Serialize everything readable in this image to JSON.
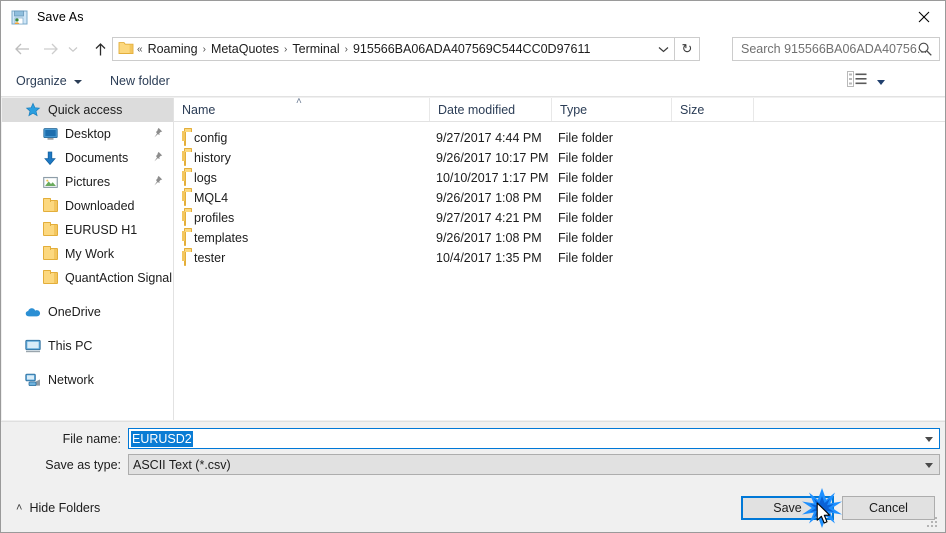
{
  "window": {
    "title": "Save As",
    "icon": "save-as-icon",
    "close_label": "✕"
  },
  "nav": {
    "back_icon": "arrow-left-icon",
    "forward_icon": "arrow-right-icon",
    "recent_icon": "chevron-down-icon",
    "up_icon": "arrow-up-icon",
    "refresh_icon": "↻",
    "breadcrumb_prefix": "«",
    "breadcrumbs": [
      "Roaming",
      "MetaQuotes",
      "Terminal",
      "915566BA06ADA407569C544CC0D97611"
    ],
    "separator": "›",
    "dropdown_icon": "chevron-down-icon"
  },
  "search": {
    "placeholder": "Search 915566BA06ADA40756...",
    "icon": "search-icon"
  },
  "commandbar": {
    "organize": "Organize",
    "new_folder": "New folder",
    "view_icon": "view-options-icon",
    "help_label": "?"
  },
  "sidebar": {
    "items": [
      {
        "label": "Quick access",
        "icon": "star-icon",
        "level": 0,
        "selected": true,
        "pinned": false
      },
      {
        "label": "Desktop",
        "icon": "monitor-icon",
        "level": 1,
        "selected": false,
        "pinned": true
      },
      {
        "label": "Documents",
        "icon": "download-icon",
        "level": 1,
        "selected": false,
        "pinned": true
      },
      {
        "label": "Pictures",
        "icon": "picture-icon",
        "level": 1,
        "selected": false,
        "pinned": true
      },
      {
        "label": "Downloaded",
        "icon": "folder-icon",
        "level": 1,
        "selected": false,
        "pinned": false
      },
      {
        "label": "EURUSD H1",
        "icon": "folder-icon",
        "level": 1,
        "selected": false,
        "pinned": false
      },
      {
        "label": "My Work",
        "icon": "folder-icon",
        "level": 1,
        "selected": false,
        "pinned": false
      },
      {
        "label": "QuantAction Signal",
        "icon": "folder-icon",
        "level": 1,
        "selected": false,
        "pinned": false
      },
      {
        "label": "OneDrive",
        "icon": "cloud-icon",
        "level": 0,
        "selected": false,
        "pinned": false,
        "gap_before": true
      },
      {
        "label": "This PC",
        "icon": "pc-icon",
        "level": 0,
        "selected": false,
        "pinned": false,
        "gap_before": true
      },
      {
        "label": "Network",
        "icon": "network-icon",
        "level": 0,
        "selected": false,
        "pinned": false,
        "gap_before": true
      }
    ]
  },
  "filelist": {
    "columns": [
      "Name",
      "Date modified",
      "Type",
      "Size"
    ],
    "sort_indicator": "˄",
    "rows": [
      {
        "name": "config",
        "date": "9/27/2017 4:44 PM",
        "type": "File folder",
        "size": ""
      },
      {
        "name": "history",
        "date": "9/26/2017 10:17 PM",
        "type": "File folder",
        "size": ""
      },
      {
        "name": "logs",
        "date": "10/10/2017 1:17 PM",
        "type": "File folder",
        "size": ""
      },
      {
        "name": "MQL4",
        "date": "9/26/2017 1:08 PM",
        "type": "File folder",
        "size": ""
      },
      {
        "name": "profiles",
        "date": "9/27/2017 4:21 PM",
        "type": "File folder",
        "size": ""
      },
      {
        "name": "templates",
        "date": "9/26/2017 1:08 PM",
        "type": "File folder",
        "size": ""
      },
      {
        "name": "tester",
        "date": "10/4/2017 1:35 PM",
        "type": "File folder",
        "size": ""
      }
    ]
  },
  "form": {
    "filename_label": "File name:",
    "filename_value": "EURUSD2",
    "savetype_label": "Save as type:",
    "savetype_value": "ASCII Text (*.csv)"
  },
  "footer": {
    "hide_folders": "Hide Folders",
    "hide_chevron": "˄",
    "save": "Save",
    "cancel": "Cancel"
  },
  "colors": {
    "accent": "#0078d7",
    "selection": "#0a7cd4",
    "sidebar_selection": "#dcdcdc",
    "header_text": "#2b3d56",
    "folder_fill": "#fcd87f"
  }
}
